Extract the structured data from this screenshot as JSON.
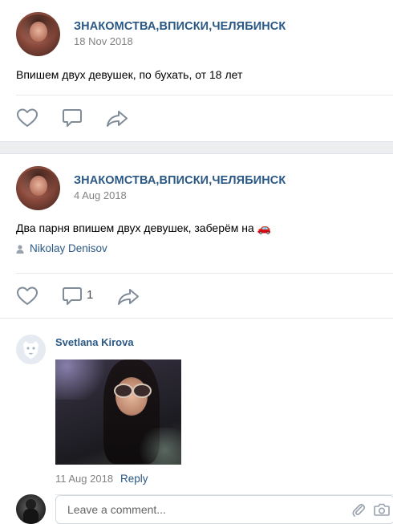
{
  "posts": [
    {
      "group_name": "ЗНАКОМСТВА,ВПИСКИ,ЧЕЛЯБИНСК",
      "date": "18 Nov 2018",
      "text": "Впишем двух девушек, по бухать, от 18 лет"
    },
    {
      "group_name": "ЗНАКОМСТВА,ВПИСКИ,ЧЕЛЯБИНСК",
      "date": "4 Aug 2018",
      "text": "Два парня впишем двух девушек, заберём на",
      "emoji": "🚗",
      "author": "Nikolay Denisov",
      "comment_count": "1"
    }
  ],
  "comment": {
    "author": "Svetlana Kirova",
    "date": "11 Aug 2018",
    "reply_label": "Reply"
  },
  "comment_input": {
    "placeholder": "Leave a comment..."
  },
  "icons": {
    "like": "heart-icon",
    "comment": "comment-bubble-icon",
    "share": "share-arrow-icon",
    "author": "person-icon",
    "attach": "paperclip-icon",
    "camera": "camera-icon",
    "default_avatar": "dog-avatar-icon"
  },
  "colors": {
    "link": "#2a5885",
    "meta": "#828282",
    "icon": "#818c99",
    "separator": "#edeef0"
  }
}
